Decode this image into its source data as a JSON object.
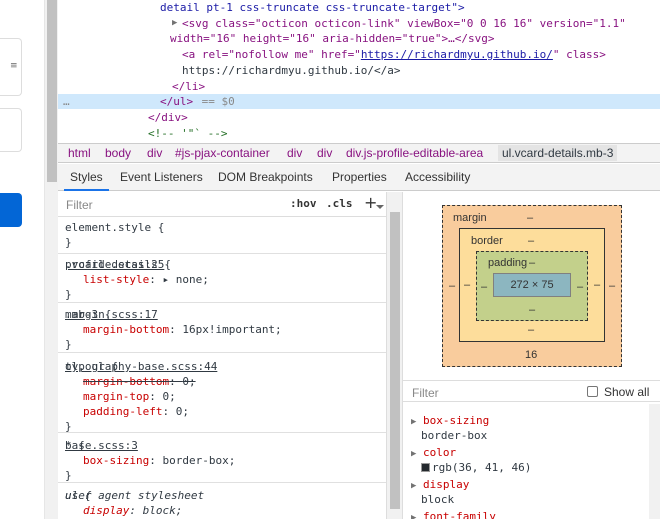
{
  "tree": {
    "lines": [
      {
        "pre": "detail pt-1 css-truncate css-truncate-target\">"
      },
      {
        "svg_open": "<svg class=\"octicon octicon-link\" viewBox=\"0 0 16 16\" version=\"1.1\"",
        "svg_cont": "width=\"16\" height=\"16\" aria-hidden=\"true\">…</svg>"
      },
      {
        "a_open": "<a rel=\"nofollow me\" href=\"",
        "a_href": "https://richardmyu.github.io/",
        "a_close": "\" class>"
      },
      {
        "text": "https://richardmyu.github.io/</a>"
      },
      {
        "li_close": "</li>"
      },
      {
        "ul_close": "</ul>",
        "eq": " == $0"
      },
      {
        "div_close": "</div>"
      },
      {
        "comment": "<!-- '\"` -->"
      }
    ],
    "ellipsis": "…"
  },
  "breadcrumb": [
    "html",
    "body",
    "div",
    "#js-pjax-container",
    "div",
    "div",
    "div.js-profile-editable-area",
    "ul.vcard-details.mb-3"
  ],
  "tabs": [
    "Styles",
    "Event Listeners",
    "DOM Breakpoints",
    "Properties",
    "Accessibility"
  ],
  "styles": {
    "filter_placeholder": "Filter",
    "hov": ":hov",
    "cls": ".cls",
    "plus": "+",
    "rules": [
      {
        "selector": "element.style {",
        "close": "}",
        "decls": []
      },
      {
        "selector": ".vcard-details {",
        "source": "profile.scss:25",
        "close": "}",
        "decls": [
          {
            "prop": "list-style",
            "val": "▸ none;"
          }
        ]
      },
      {
        "selector": ".mb-3 {",
        "source": "margin.scss:17",
        "close": "}",
        "decls": [
          {
            "prop": "margin-bottom",
            "val": "16px!important;"
          }
        ]
      },
      {
        "selector": "ol, ul {",
        "source": "typography-base.scss:44",
        "close": "}",
        "decls": [
          {
            "prop": "margin-bottom",
            "val": "0;",
            "struck": true
          },
          {
            "prop": "margin-top",
            "val": "0;"
          },
          {
            "prop": "padding-left",
            "val": "0;"
          }
        ]
      },
      {
        "selector": "* {",
        "source": "base.scss:3",
        "close": "}",
        "decls": [
          {
            "prop": "box-sizing",
            "val": "border-box;"
          }
        ]
      },
      {
        "selector": "ul {",
        "source": "user agent stylesheet",
        "decls": [
          {
            "prop": "display",
            "val": "block;"
          }
        ]
      }
    ]
  },
  "boxmodel": {
    "margin_label": "margin",
    "margin_top": "–",
    "margin_left": "–",
    "margin_right": "–",
    "margin_bottom": "16",
    "border_label": "border",
    "border_top": "–",
    "border_left": "–",
    "border_right": "–",
    "border_bottom": "–",
    "padding_label": "padding",
    "padding_top": "–",
    "padding_left": "–",
    "padding_right": "–",
    "padding_bottom": "–",
    "content": "272 × 75",
    "colors": {
      "margin": "#f9cc9d",
      "border": "#fddd9b",
      "padding": "#c3d08b",
      "content": "#8cb6c0"
    }
  },
  "computed": {
    "filter_placeholder": "Filter",
    "show_all": "Show all",
    "props": [
      {
        "name": "box-sizing",
        "value": "border-box"
      },
      {
        "name": "color",
        "value": "rgb(36, 41, 46)",
        "swatch": "#24292e"
      },
      {
        "name": "display",
        "value": "block"
      },
      {
        "name": "font-family",
        "value": ""
      }
    ]
  }
}
